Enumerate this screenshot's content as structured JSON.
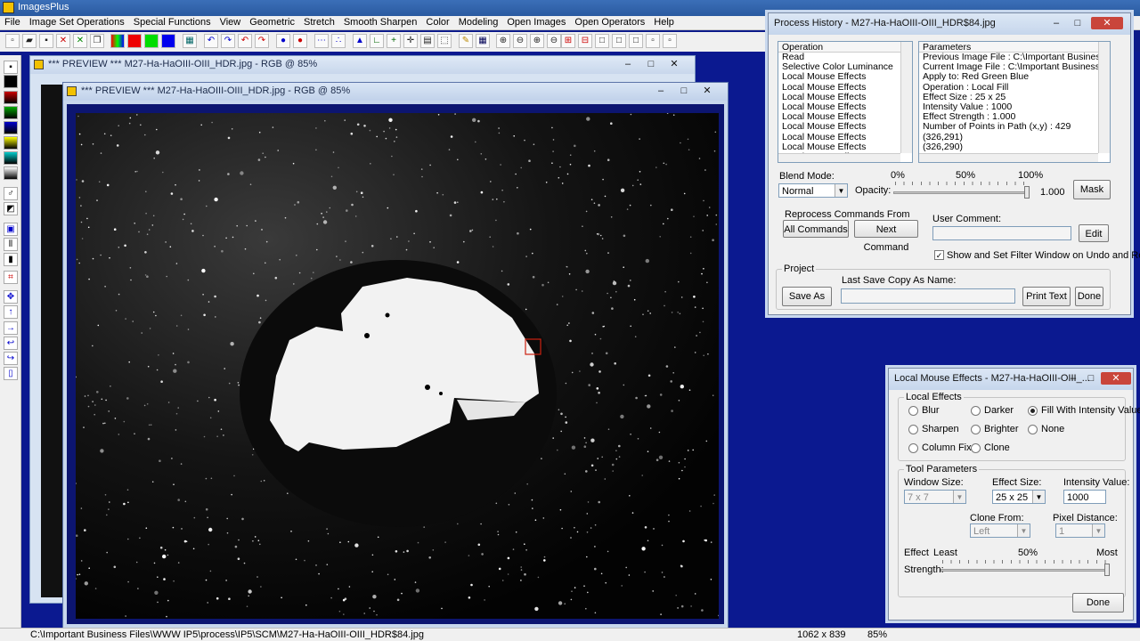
{
  "app": {
    "title": "ImagesPlus"
  },
  "menu": [
    "File",
    "Image Set Operations",
    "Special Functions",
    "View",
    "Geometric",
    "Stretch",
    "Smooth Sharpen",
    "Color",
    "Modeling",
    "Open Images",
    "Open Operators",
    "Help"
  ],
  "preview_back": {
    "title": "*** PREVIEW *** M27-Ha-HaOIII-OIII_HDR.jpg - RGB @ 85%"
  },
  "preview_front": {
    "title": "*** PREVIEW *** M27-Ha-HaOIII-OIII_HDR.jpg - RGB @ 85%"
  },
  "window_controls": {
    "minimize": "–",
    "maximize": "□",
    "close": "✕"
  },
  "process_history": {
    "title": "Process History - M27-Ha-HaOIII-OIII_HDR$84.jpg",
    "operation_header": "Operation",
    "operations": [
      "Read",
      "Selective Color Luminance",
      "Local Mouse Effects",
      "Local Mouse Effects",
      "Local Mouse Effects",
      "Local Mouse Effects",
      "Local Mouse Effects",
      "Local Mouse Effects",
      "Local Mouse Effects",
      "Local Mouse Effects",
      "Local Mouse Effects"
    ],
    "parameters_header": "Parameters",
    "parameters": [
      "Previous Image File : C:\\Important Business Files\\W",
      "Current Image File : C:\\Important Business Files\\W",
      "Apply to:  Red Green Blue",
      "Operation : Local Fill",
      "Effect Size : 25 x 25",
      "Intensity Value : 1000",
      "Effect Strength : 1.000",
      "Number of Points in Path (x,y) : 429",
      "(326,291)",
      "(326,290)"
    ],
    "blend_mode_label": "Blend Mode:",
    "blend_mode_value": "Normal",
    "opacity_label": "Opacity:",
    "opacity_ticks": {
      "p0": "0%",
      "p50": "50%",
      "p100": "100%"
    },
    "opacity_value": "1.000",
    "opacity_fraction": 1.0,
    "mask_button": "Mask",
    "reprocess_group": "Reprocess Commands From Current >>",
    "all_commands_button": "All Commands",
    "next_command_button": "Next Command",
    "user_comment_label": "User Comment:",
    "user_comment_value": "",
    "edit_button": "Edit",
    "show_filter_checkbox": "Show and Set Filter Window on Undo and Redo",
    "show_filter_checked": true,
    "project_group": "Project",
    "last_save_label": "Last Save Copy As Name:",
    "save_as_button": "Save As",
    "last_save_value": "",
    "print_text_button": "Print Text",
    "done_button": "Done"
  },
  "local_effects": {
    "title": "Local Mouse Effects - M27-Ha-HaOIII-OIII_...",
    "effects_group": "Local Effects",
    "effects": [
      {
        "label": "Blur",
        "selected": false
      },
      {
        "label": "Darker",
        "selected": false
      },
      {
        "label": "Fill With Intensity Value",
        "selected": true
      },
      {
        "label": "Sharpen",
        "selected": false
      },
      {
        "label": "Brighter",
        "selected": false
      },
      {
        "label": "None",
        "selected": false
      },
      {
        "label": "Column Fix",
        "selected": false
      },
      {
        "label": "Clone",
        "selected": false
      }
    ],
    "tool_group": "Tool Parameters",
    "window_size_label": "Window Size:",
    "window_size_value": "7 x 7",
    "effect_size_label": "Effect Size:",
    "effect_size_value": "25 x 25",
    "intensity_label": "Intensity Value:",
    "intensity_value": "1000",
    "clone_from_label": "Clone From:",
    "clone_from_value": "Left",
    "pixel_distance_label": "Pixel Distance:",
    "pixel_distance_value": "1",
    "effect_label": "Effect",
    "strength_label": "Strength:",
    "least_label": "Least",
    "mid_label": "50%",
    "most_label": "Most",
    "strength_fraction": 1.0,
    "done_button": "Done"
  },
  "status": {
    "path": "C:\\Important Business Files\\WWW IP5\\process\\IP5\\SCM\\M27-Ha-HaOIII-OIII_HDR$84.jpg",
    "dimensions": "1062 x 839",
    "zoom": "85%"
  }
}
